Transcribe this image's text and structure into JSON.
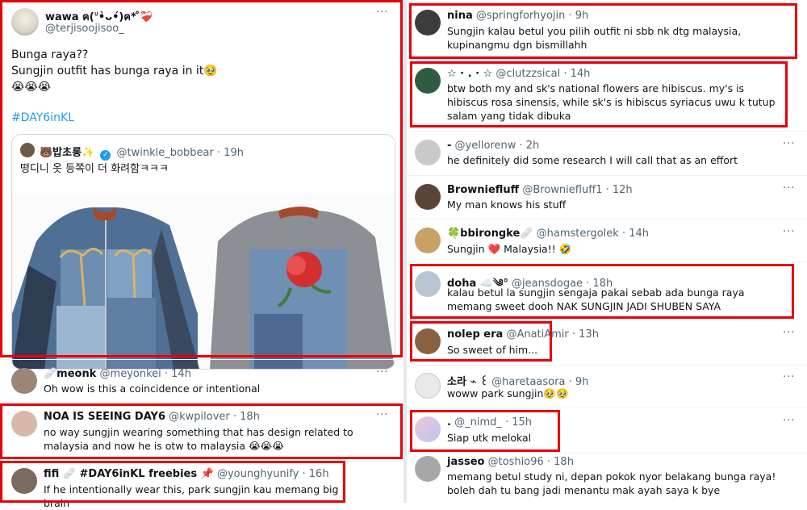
{
  "left": {
    "main_tweet": {
      "name": "wawa ฅ(ᐡ•̀ᴗ•́)ฅ* ̊❤️‍🩹",
      "handle": "@terjisoojisoo_",
      "line1": "Bunga raya??",
      "line2": "Sungjin outfit has bunga raya in it🥹",
      "line3": "😭😭😭",
      "hashtag": "#DAY6inKL",
      "quote": {
        "name": "🐻밥초롱✨",
        "handle": "@twinkle_bobbear · 19h",
        "text": "떵디니 옷 등쪽이 더 화려함ㅋㅋㅋ"
      }
    },
    "replies": [
      {
        "name": "🩹meonk",
        "handle": "@meyonkei · 14h",
        "text": "Oh wow is this a coincidence or intentional"
      },
      {
        "name": "NOA IS SEEING DAY6",
        "handle": "@kwpilover · 18h",
        "text": "no way sungjin wearing something that has design related to malaysia and now he is otw to malaysia 😭😭😭"
      },
      {
        "name": "fifi 🩹 #DAY6inKL freebies 📌",
        "handle": "@younghyunify · 16h",
        "text": "If he intentionally wear this, park sungjin kau memang big brain"
      }
    ]
  },
  "right": {
    "replies": [
      {
        "name": "nina",
        "handle": "@springforhyojin · 9h",
        "text": "Sungjin kalau betul you pilih outfit ni sbb nk dtg malaysia, kupinangmu dgn bismillahh"
      },
      {
        "name": "☆ · . · ☆",
        "handle": "@clutzzsical · 14h",
        "text": "btw both my and sk's national flowers are hibiscus. my's is hibiscus rosa sinensis, while sk's is hibiscus syriacus uwu k tutup salam yang tidak dibuka"
      },
      {
        "name": "-",
        "handle": "@yellorenw · 2h",
        "text": "he definitely did some research I will call that as an effort"
      },
      {
        "name": "Browniefluff",
        "handle": "@Browniefluff1 · 12h",
        "text": "My man knows his stuff"
      },
      {
        "name": "🍀bbirongke🩹",
        "handle": "@hamstergolek · 14h",
        "text": "Sungjin ❤️ Malaysia!! 🤣"
      },
      {
        "name": "doha ☁️༄°",
        "handle": "@jeansdogae · 18h",
        "text": "kalau betul la sungjin sengaja pakai sebab ada bunga raya memang sweet dooh NAK SUNGJIN JADI SHUBEN SAYA"
      },
      {
        "name": "nolep era",
        "handle": "@AnatiAmir · 13h",
        "text": "So sweet of him..."
      },
      {
        "name": "소라 ⌁ ꒰",
        "handle": "@haretaasora · 9h",
        "text": "woww park sungjin🥹🥹"
      },
      {
        "name": ".",
        "handle": "@_nimd_ · 15h",
        "text": "Siap utk melokal"
      },
      {
        "name": "jasseo",
        "handle": "@toshio96 · 18h",
        "text": "memang betul study ni, depan pokok nyor belakang bunga raya! boleh dah tu bang jadi menantu mak ayah saya k bye"
      }
    ]
  },
  "more_label": "···",
  "colors": {
    "highlight": "#e8000b",
    "link": "#1d9bf0",
    "verified": "#1d9bf0"
  }
}
